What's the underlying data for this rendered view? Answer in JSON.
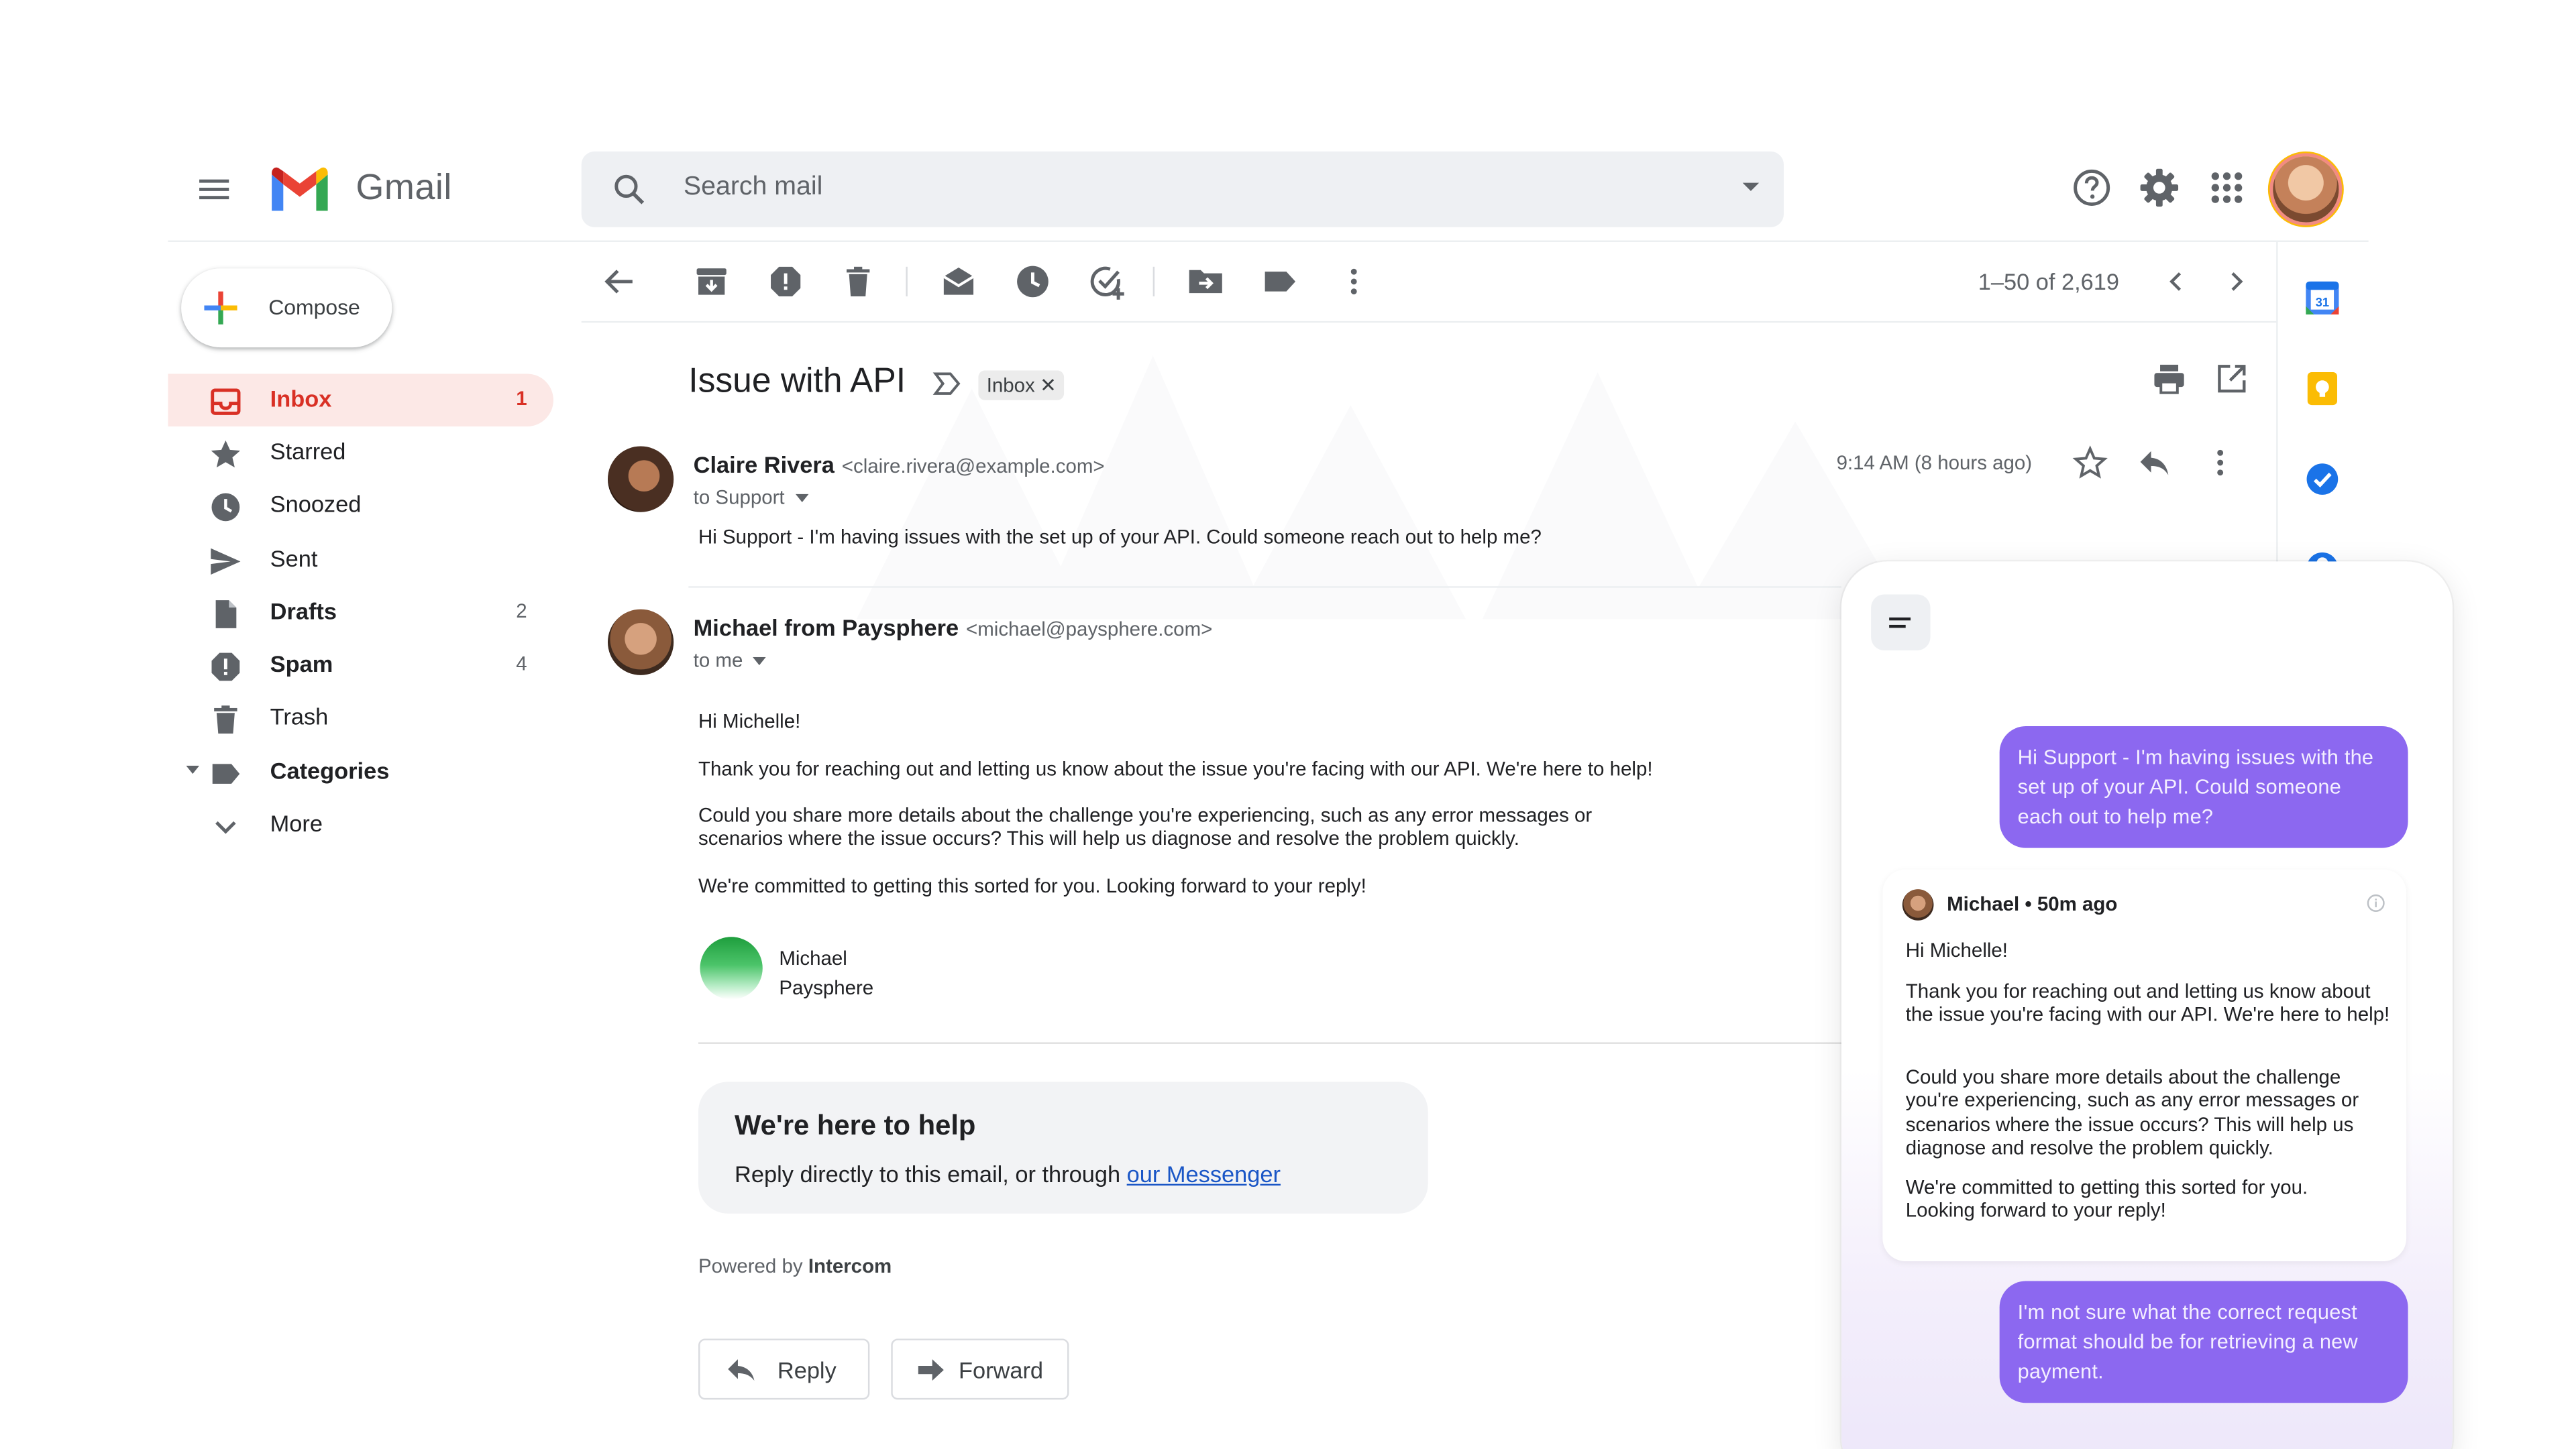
{
  "app": {
    "name": "Gmail"
  },
  "search": {
    "placeholder": "Search mail"
  },
  "compose": {
    "label": "Compose"
  },
  "sidebar": {
    "items": [
      {
        "label": "Inbox",
        "count": "1"
      },
      {
        "label": "Starred",
        "count": ""
      },
      {
        "label": "Snoozed",
        "count": ""
      },
      {
        "label": "Sent",
        "count": ""
      },
      {
        "label": "Drafts",
        "count": "2"
      },
      {
        "label": "Spam",
        "count": "4"
      },
      {
        "label": "Trash",
        "count": ""
      },
      {
        "label": "Categories",
        "count": ""
      },
      {
        "label": "More",
        "count": ""
      }
    ]
  },
  "toolbar": {
    "pager": "1–50 of 2,619"
  },
  "thread": {
    "subject": "Issue with API",
    "label_chip": "Inbox",
    "messages": [
      {
        "sender": "Claire Rivera",
        "email": "<claire.rivera@example.com>",
        "to": "to Support",
        "time": "9:14 AM (8 hours ago)",
        "body": "Hi Support - I'm having issues with the set up of your API. Could someone reach out to help me?"
      },
      {
        "sender": "Michael from Paysphere",
        "email": "<michael@paysphere.com>",
        "to": "to me",
        "greeting": "Hi Michelle!",
        "p1": "Thank you for reaching out and letting us know about the issue you're facing with our API. We're here to help!",
        "p2a": "Could you share more details about the challenge you're experiencing, such as any error messages or",
        "p2b": "scenarios where the issue occurs? This will help us diagnose and resolve the problem quickly.",
        "p3": "We're committed to getting this sorted for you. Looking forward to your reply!",
        "sig_name": "Michael",
        "sig_company": "Paysphere"
      }
    ]
  },
  "help_card": {
    "title": "We're here to help",
    "text": "Reply directly to this email, or through",
    "link": "our Messenger"
  },
  "powered": {
    "prefix": "Powered by",
    "brand": "Intercom"
  },
  "actions": {
    "reply": "Reply",
    "forward": "Forward"
  },
  "rail": {
    "calendar_day": "31"
  },
  "messenger": {
    "out1": "Hi Support - I'm having issues with the set up of your API. Could someone each out to help me?",
    "in_header": "Michael • 50m ago",
    "in_greeting": "Hi Michelle!",
    "in_p1": "Thank you for reaching out and letting us know about the issue you're facing with our API. We're here to help!",
    "in_p2": "Could you share more details about the challenge you're experiencing, such as any error messages or scenarios where the issue occurs? This will help us diagnose and resolve the problem quickly.",
    "in_p3": "We're committed to getting this sorted for you. Looking forward to your reply!",
    "out2": "I'm not sure what the correct request format should be for retrieving a new payment."
  },
  "colors": {
    "inbox_active_bg": "#fce8e6",
    "inbox_active_text": "#d93025",
    "messenger_bubble": "#8c68f0",
    "link": "#1a56c6"
  }
}
